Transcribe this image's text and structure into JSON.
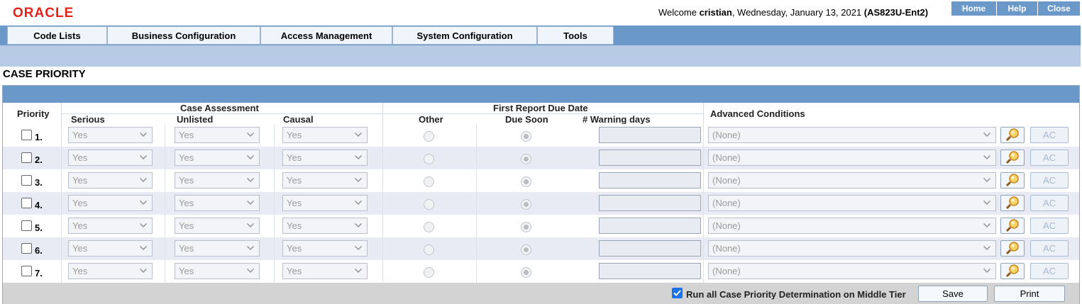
{
  "header": {
    "logo": "ORACLE",
    "welcome_prefix": "Welcome ",
    "user": "cristian",
    "date_text": ", Wednesday, January 13, 2021 ",
    "env": "(AS823U-Ent2)",
    "nav": {
      "home": "Home",
      "help": "Help",
      "close": "Close"
    }
  },
  "menu": [
    "Code Lists",
    "Business Configuration",
    "Access Management",
    "System Configuration",
    "Tools"
  ],
  "page_title": "CASE PRIORITY",
  "table": {
    "headers": {
      "priority": "Priority",
      "case_assessment": "Case Assessment",
      "serious": "Serious",
      "unlisted": "Unlisted",
      "causal": "Causal",
      "first_report": "First Report Due Date",
      "other": "Other",
      "due_soon": "Due Soon",
      "warning_days": "# Warning days",
      "advanced": "Advanced Conditions"
    },
    "rows": [
      {
        "num": "1.",
        "serious": "Yes",
        "unlisted": "Yes",
        "causal": "Yes",
        "condition": "(None)",
        "ac": "AC"
      },
      {
        "num": "2.",
        "serious": "Yes",
        "unlisted": "Yes",
        "causal": "Yes",
        "condition": "(None)",
        "ac": "AC"
      },
      {
        "num": "3.",
        "serious": "Yes",
        "unlisted": "Yes",
        "causal": "Yes",
        "condition": "(None)",
        "ac": "AC"
      },
      {
        "num": "4.",
        "serious": "Yes",
        "unlisted": "Yes",
        "causal": "Yes",
        "condition": "(None)",
        "ac": "AC"
      },
      {
        "num": "5.",
        "serious": "Yes",
        "unlisted": "Yes",
        "causal": "Yes",
        "condition": "(None)",
        "ac": "AC"
      },
      {
        "num": "6.",
        "serious": "Yes",
        "unlisted": "Yes",
        "causal": "Yes",
        "condition": "(None)",
        "ac": "AC"
      },
      {
        "num": "7.",
        "serious": "Yes",
        "unlisted": "Yes",
        "causal": "Yes",
        "condition": "(None)",
        "ac": "AC"
      }
    ]
  },
  "footer": {
    "run_label": "Run all Case Priority Determination on Middle Tier",
    "save": "Save",
    "print": "Print"
  },
  "colors": {
    "brand": "#e2231a",
    "accent": "#6a98c9",
    "submenu": "#b7cbe5",
    "row_alt": "#e9ebf4"
  }
}
